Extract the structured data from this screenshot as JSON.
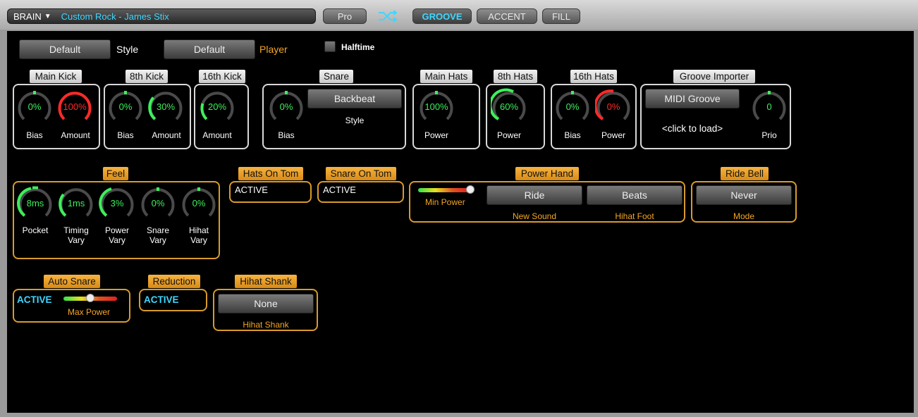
{
  "topbar": {
    "brain_label": "BRAIN",
    "brain_arrow": "▼",
    "preset": "Custom Rock - James Stix",
    "pro": "Pro",
    "shuffle_icon": "shuffle-icon",
    "groove": "GROOVE",
    "accent": "ACCENT",
    "fill": "FILL"
  },
  "header": {
    "style_button": "Default",
    "style_label": "Style",
    "player_button": "Default",
    "player_label": "Player",
    "halftime_label": "Halftime"
  },
  "groups": {
    "main_kick": {
      "title": "Main Kick",
      "bias": "0%",
      "bias_label": "Bias",
      "amount": "100%",
      "amount_label": "Amount"
    },
    "eighth_kick": {
      "title": "8th Kick",
      "bias": "0%",
      "bias_label": "Bias",
      "amount": "30%",
      "amount_label": "Amount"
    },
    "sixteenth_kick": {
      "title": "16th Kick",
      "amount": "20%",
      "amount_label": "Amount"
    },
    "snare": {
      "title": "Snare",
      "bias": "0%",
      "bias_label": "Bias",
      "style_button": "Backbeat",
      "style_label": "Style"
    },
    "main_hats": {
      "title": "Main Hats",
      "power": "100%",
      "power_label": "Power"
    },
    "eighth_hats": {
      "title": "8th Hats",
      "power": "60%",
      "power_label": "Power"
    },
    "sixteenth_hats": {
      "title": "16th Hats",
      "bias": "0%",
      "bias_label": "Bias",
      "power": "0%",
      "power_label": "Power"
    },
    "groove_importer": {
      "title": "Groove Importer",
      "button": "MIDI Groove",
      "load_text": "<click to load>",
      "prio": "0",
      "prio_label": "Prio"
    },
    "feel": {
      "title": "Feel",
      "knobs": [
        {
          "value": "8ms",
          "label1": "Pocket",
          "label2": ""
        },
        {
          "value": "1ms",
          "label1": "Timing",
          "label2": "Vary"
        },
        {
          "value": "3%",
          "label1": "Power",
          "label2": "Vary"
        },
        {
          "value": "0%",
          "label1": "Snare",
          "label2": "Vary"
        },
        {
          "value": "0%",
          "label1": "Hihat",
          "label2": "Vary"
        }
      ]
    },
    "hats_on_tom": {
      "title": "Hats On Tom",
      "status": "ACTIVE"
    },
    "snare_on_tom": {
      "title": "Snare On Tom",
      "status": "ACTIVE"
    },
    "power_hand": {
      "title": "Power Hand",
      "min_power_label": "Min Power",
      "ride_button": "Ride",
      "new_sound_label": "New Sound",
      "beats_button": "Beats",
      "hihat_foot_label": "Hihat Foot"
    },
    "ride_bell": {
      "title": "Ride Bell",
      "button": "Never",
      "mode_label": "Mode"
    },
    "auto_snare": {
      "title": "Auto Snare",
      "status": "ACTIVE",
      "max_power_label": "Max Power"
    },
    "reduction": {
      "title": "Reduction",
      "status": "ACTIVE"
    },
    "hihat_shank": {
      "title": "Hihat Shank",
      "button": "None",
      "label": "Hihat Shank"
    }
  },
  "colors": {
    "accent_cyan": "#3fd6ff",
    "knob_green": "#3cf05a",
    "knob_red": "#ff2a2a",
    "orange": "#f5a623",
    "knob_track": "#4a4a4a"
  }
}
